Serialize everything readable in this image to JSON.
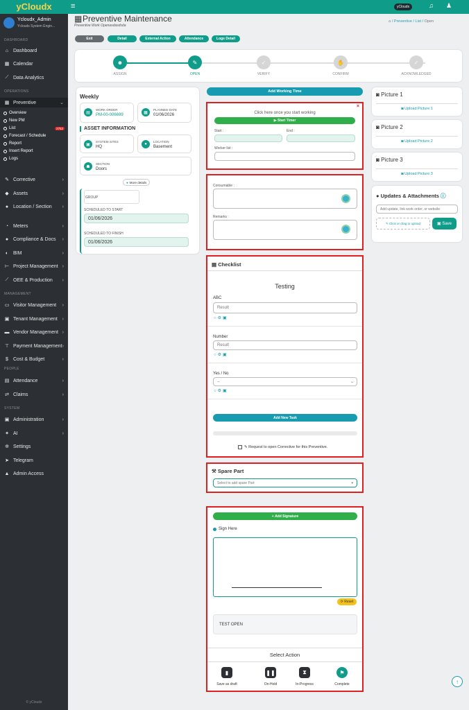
{
  "app": {
    "logo": "yCloudx",
    "brand_badge": "yCloudx",
    "footer": "© yCloudx"
  },
  "user": {
    "name": "Ycloudx_Admin",
    "company": "Yclouds System Engin..."
  },
  "sidebar": {
    "sections": {
      "dashboard": "DASHBOARD",
      "operations": "OPERATIONS",
      "management": "MANAGEMENT",
      "people": "PEOPLE",
      "system": "SYSTEM"
    },
    "dashboard_items": [
      "Dashboard",
      "Calendar",
      "Data Analytics"
    ],
    "preventive": "Preventive",
    "preventive_sub": [
      "Overview",
      "New PM",
      "List",
      "Forecast / Schedule",
      "Report",
      "Insert Report",
      "Logs"
    ],
    "list_badge": "2752",
    "operations_items": [
      "Corrective",
      "Assets",
      "Location / Section",
      "Meters",
      "Compliance & Docs",
      "BIM",
      "Project Management",
      "OEE & Production"
    ],
    "management_items": [
      "Visitor Management",
      "Tenant Management",
      "Vendor Management",
      "Payment Management",
      "Cost & Budget"
    ],
    "people_items": [
      "Attendance",
      "Claims"
    ],
    "system_items": [
      "Administration",
      "AI",
      "Settings",
      "Telegram",
      "Admin Access"
    ]
  },
  "header": {
    "title": "Preventive Maintenance",
    "subtitle": "Preventive Work Openasdasdsda",
    "breadcrumb": [
      "Preventive",
      "List",
      "Open"
    ]
  },
  "actions": {
    "exit": "Exit",
    "detail": "Detail",
    "external": "External Action",
    "attendance": "Attendance",
    "logs": "Logs Detail"
  },
  "steps": [
    "ASSIGN",
    "OPEN",
    "VERIFY",
    "CONFIRM",
    "ACKNOWLEDGED"
  ],
  "left": {
    "frequency": "Weekly",
    "work_order_label": "WORK ORDER",
    "work_order": "PM-00-006699",
    "planned_label": "PLANNED DATE",
    "planned": "01/06/2026",
    "asset_info": "ASSET INFORMATION",
    "system_label": "SYSTEM SITES",
    "system": "HQ",
    "location_label": "LOCATION",
    "location": "Basement",
    "section_label": "SECTION",
    "section": "Doors",
    "more": "More details",
    "group_label": "GROUP",
    "start_label": "SCHEDULED TO START",
    "start": "01/06/2026",
    "finish_label": "SCHEDULED TO FINISH",
    "finish": "01/06/2026"
  },
  "working": {
    "add_time": "Add Working Time",
    "hint": "Click here once you start working",
    "start_timer": "Start Timer",
    "start_label": "Start :",
    "end_label": "End :",
    "worker_label": "Worker list :",
    "consumable": "Consumable :",
    "remarks": "Remarks :"
  },
  "checklist": {
    "title": "Checklist",
    "heading": "Testing",
    "items": [
      {
        "label": "ABC",
        "placeholder": "Result"
      },
      {
        "label": "Number",
        "placeholder": "Result"
      },
      {
        "label": "Yes / No",
        "value": "--"
      }
    ],
    "add_task": "Add New Task",
    "request": "Request to open Corrective for this Preventive."
  },
  "spare": {
    "title": "Spare Part",
    "placeholder": "Select to add spare Part"
  },
  "signature": {
    "add": "Add Signature",
    "sign_here": "Sign Here",
    "reset": "Reset",
    "note": "TEST OPEN",
    "select_action": "Select Action",
    "buttons": [
      "Save as draft",
      "On-Hold",
      "In-Progress",
      "Complete"
    ]
  },
  "pictures": [
    {
      "title": "Picture 1",
      "upload": "Upload Picture 1"
    },
    {
      "title": "Picture 2",
      "upload": "Upload Picture 2"
    },
    {
      "title": "Picture 3",
      "upload": "Upload Picture 3"
    }
  ],
  "updates": {
    "title": "Updates & Attachments",
    "placeholder": "Add update, link work order, or website",
    "upload": "Click or drag to upload",
    "save": "Save"
  },
  "colors": {
    "teal": "#0f9d8a",
    "sidebar": "#2c3034",
    "red": "#e02020",
    "cyan": "#179bb0"
  }
}
